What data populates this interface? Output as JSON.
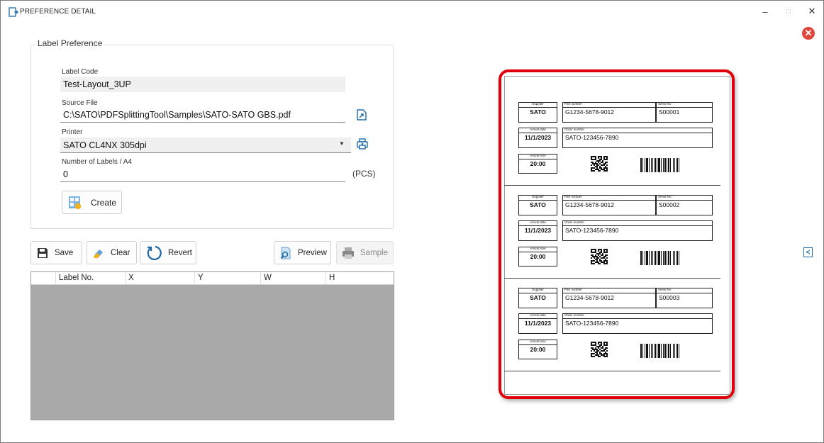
{
  "window": {
    "title": "PREFERENCE DETAIL",
    "controls": {
      "minimize": "–",
      "maximize": "□",
      "close": "✕"
    }
  },
  "close_badge": "✕",
  "group": {
    "legend": "Label Preference",
    "label_code": {
      "label": "Label Code",
      "value": "Test-Layout_3UP"
    },
    "source_file": {
      "label": "Source File",
      "value": "C:\\SATO\\PDFSplittingTool\\Samples\\SATO-SATO GBS.pdf"
    },
    "printer": {
      "label": "Printer",
      "value": "SATO CL4NX 305dpi"
    },
    "labels_per_a4": {
      "label": "Number of Labels / A4",
      "value": "0",
      "unit": "(PCS)"
    },
    "create_label": "Create"
  },
  "toolbar": {
    "save": "Save",
    "clear": "Clear",
    "revert": "Revert",
    "preview": "Preview",
    "sample": "Sample"
  },
  "grid": {
    "columns": [
      "Label No.",
      "X",
      "Y",
      "W",
      "H"
    ]
  },
  "preview": {
    "captions": {
      "supplier": "Supplier",
      "part": "Part number",
      "serial": "Serial No",
      "arrival_date": "Arrival date",
      "order": "Order number",
      "arrival_time": "Arrival time"
    },
    "labels": [
      {
        "supplier": "SATO",
        "part": "G1234-5678-9012",
        "serial": "S00001",
        "date": "11/1/2023",
        "order": "SATO-123456-7890",
        "time": "20:00"
      },
      {
        "supplier": "SATO",
        "part": "G1234-5678-9012",
        "serial": "S00002",
        "date": "11/1/2023",
        "order": "SATO-123456-7890",
        "time": "20:00"
      },
      {
        "supplier": "SATO",
        "part": "G1234-5678-9012",
        "serial": "S00003",
        "date": "11/1/2023",
        "order": "SATO-123456-7890",
        "time": "20:00"
      }
    ]
  },
  "side_toggle": "<",
  "colors": {
    "accent_red": "#e0000c",
    "icon_blue": "#1e6aa8",
    "grid_bg": "#a9a9a9"
  }
}
